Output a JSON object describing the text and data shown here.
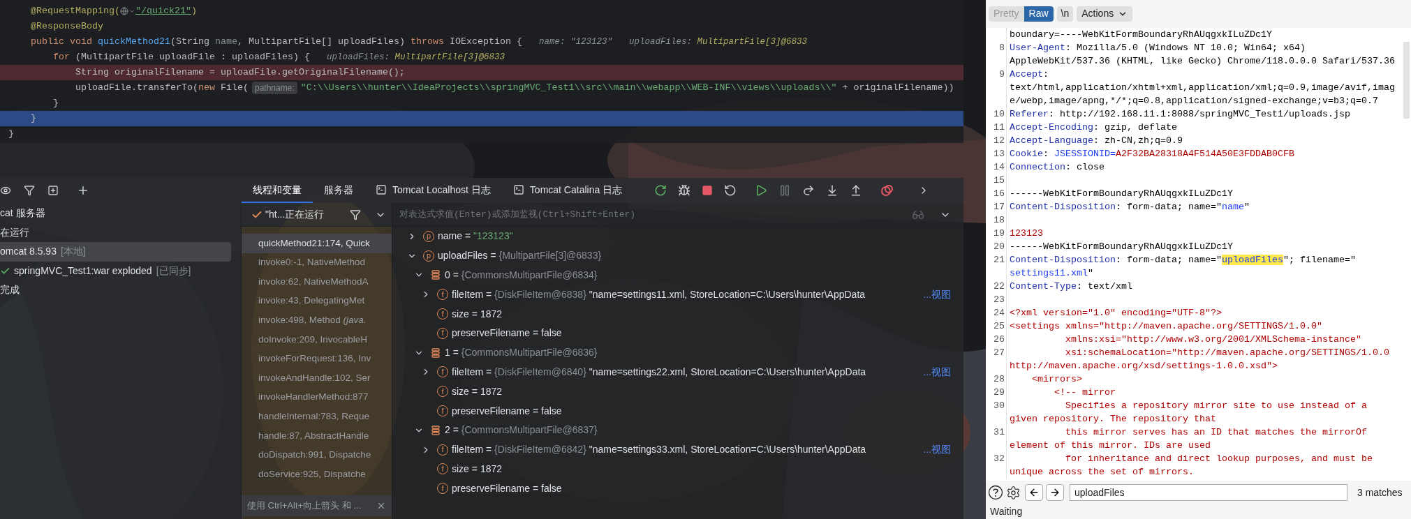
{
  "editor": {
    "lines": [
      {
        "parts": [
          {
            "kind": "code",
            "tokens": [
              {
                "kind": "annotation",
                "text": "    @RequestMapping("
              }
            ]
          },
          {
            "kind": "icon"
          },
          {
            "kind": "code",
            "tokens": [
              {
                "kind": "link",
                "text": "\"/quick21\""
              },
              {
                "kind": "annotation",
                "text": ")"
              }
            ]
          }
        ]
      },
      {
        "parts": [
          {
            "kind": "code",
            "tokens": [
              {
                "kind": "annotation",
                "text": "    @ResponseBody"
              }
            ]
          }
        ]
      },
      {
        "parts": [
          {
            "kind": "code",
            "tokens": [
              {
                "kind": "keyword",
                "text": "    public void "
              },
              {
                "kind": "method",
                "text": "quickMethod21"
              },
              {
                "kind": "plain",
                "text": "(String "
              },
              {
                "kind": "unused",
                "text": "name"
              },
              {
                "kind": "plain",
                "text": ", MultipartFile[] uploadFiles) "
              },
              {
                "kind": "keyword",
                "text": "throws "
              },
              {
                "kind": "plain",
                "text": "IOException {"
              }
            ]
          },
          {
            "kind": "hint",
            "tokens": [
              {
                "kind": "hint",
                "text": "name: \"123123\""
              }
            ]
          },
          {
            "kind": "hint",
            "tokens": [
              {
                "kind": "hint",
                "text": "uploadFiles: "
              },
              {
                "kind": "hint-type",
                "text": "MultipartFile[3]@6833"
              }
            ]
          }
        ]
      },
      {
        "parts": [
          {
            "kind": "code",
            "tokens": [
              {
                "kind": "keyword",
                "text": "        for "
              },
              {
                "kind": "plain",
                "text": "(MultipartFile uploadFile : uploadFiles) {"
              }
            ]
          },
          {
            "kind": "hint",
            "tokens": [
              {
                "kind": "hint",
                "text": "uploadFiles: "
              },
              {
                "kind": "hint-type",
                "text": "MultipartFile[3]@6833"
              }
            ]
          }
        ]
      },
      {
        "breakpoint": true,
        "current": false,
        "parts": [
          {
            "kind": "code",
            "tokens": [
              {
                "kind": "plain",
                "text": "            String originalFilename = uploadFile.getOriginalFilename();"
              }
            ]
          }
        ]
      },
      {
        "parts": [
          {
            "kind": "code",
            "tokens": [
              {
                "kind": "plain",
                "text": "            uploadFile.transferTo("
              },
              {
                "kind": "keyword",
                "text": "new "
              },
              {
                "kind": "plain",
                "text": "File("
              }
            ]
          },
          {
            "kind": "param-hint",
            "text": "pathname:"
          },
          {
            "kind": "code",
            "tokens": [
              {
                "kind": "string",
                "text": "\"C:\\\\Users\\\\hunter\\\\IdeaProjects\\\\springMVC_Test1\\\\src\\\\main\\\\webapp\\\\WEB-INF\\\\views\\\\uploads\\\\\""
              },
              {
                "kind": "plain",
                "text": " + originalFilename))"
              }
            ]
          }
        ]
      },
      {
        "parts": [
          {
            "kind": "code",
            "tokens": [
              {
                "kind": "plain",
                "text": "        }"
              }
            ]
          }
        ]
      },
      {
        "breakpoint": false,
        "current": true,
        "parts": [
          {
            "kind": "code",
            "tokens": [
              {
                "kind": "plain",
                "text": "    }"
              }
            ]
          }
        ]
      },
      {
        "parts": [
          {
            "kind": "code",
            "tokens": [
              {
                "kind": "plain",
                "text": "}"
              }
            ]
          }
        ]
      }
    ]
  },
  "services": {
    "items": [
      {
        "label": "cat 服务器",
        "selected": false
      },
      {
        "label": "在运行",
        "selected": false
      },
      {
        "label": "omcat 8.5.93",
        "tag": "[本地]",
        "selected": true
      },
      {
        "label": "springMVC_Test1:war exploded",
        "tag": "[已同步]",
        "done": true,
        "selected": false
      },
      {
        "label": "完成",
        "selected": false
      }
    ]
  },
  "debugger": {
    "tabs": [
      {
        "label": "线程和变量",
        "kind": "view",
        "selected": true
      },
      {
        "label": "服务器",
        "kind": "view",
        "selected": false
      },
      {
        "label": "Tomcat Localhost 日志",
        "kind": "console",
        "selected": false
      },
      {
        "label": "Tomcat Catalina 日志",
        "kind": "console",
        "selected": false
      }
    ],
    "thread": "\"ht...正在运行",
    "eval_placeholder": "对表达式求值(Enter)或添加监视(Ctrl+Shift+Enter)",
    "frames": [
      {
        "label": "quickMethod21:174, Quick",
        "selected": true
      },
      {
        "label": "invoke0:-1, NativeMethod",
        "selected": false
      },
      {
        "label": "invoke:62, NativeMethodA",
        "selected": false
      },
      {
        "label": "invoke:43, DelegatingMet",
        "selected": false
      },
      {
        "label": "invoke:498, Method *(java.*",
        "selected": false
      },
      {
        "label": "doInvoke:209, InvocableH",
        "selected": false
      },
      {
        "label": "invokeForRequest:136, Inv",
        "selected": false
      },
      {
        "label": "invokeAndHandle:102, Ser",
        "selected": false
      },
      {
        "label": "invokeHandlerMethod:877",
        "selected": false
      },
      {
        "label": "handleInternal:783, Reque",
        "selected": false
      },
      {
        "label": "handle:87, AbstractHandle",
        "selected": false
      },
      {
        "label": "doDispatch:991, Dispatche",
        "selected": false
      },
      {
        "label": "doService:925, Dispatche",
        "selected": false
      }
    ],
    "frames_hint": "使用 Ctrl+Alt+向上箭头 和 ...",
    "variables": [
      {
        "kind": "param",
        "badge": "p",
        "name": "name",
        "operator": "=",
        "value": "\"123123\"",
        "string_value": true,
        "expanded": false
      },
      {
        "kind": "param",
        "badge": "p",
        "name": "uploadFiles",
        "operator": "=",
        "type": "{MultipartFile[3]@6833}",
        "expanded": true,
        "children": [
          {
            "kind": "object",
            "name": "0",
            "operator": "=",
            "type": "{CommonsMultipartFile@6834}",
            "expanded": true,
            "children": [
              {
                "kind": "field",
                "badge": "f",
                "name": "fileItem",
                "operator": "=",
                "type": "{DiskFileItem@6838}",
                "value": "\"name=settings11.xml, StoreLocation=C:\\Users\\hunter\\AppData",
                "string_value": false,
                "link": "...视图",
                "expanded": false
              },
              {
                "kind": "field",
                "badge": "f",
                "name": "size",
                "operator": "=",
                "value": "1872",
                "string_value": false
              },
              {
                "kind": "field",
                "badge": "f",
                "name": "preserveFilename",
                "operator": "=",
                "value": "false",
                "string_value": false
              }
            ]
          },
          {
            "kind": "object",
            "name": "1",
            "operator": "=",
            "type": "{CommonsMultipartFile@6836}",
            "expanded": true,
            "children": [
              {
                "kind": "field",
                "badge": "f",
                "name": "fileItem",
                "operator": "=",
                "type": "{DiskFileItem@6840}",
                "value": "\"name=settings22.xml, StoreLocation=C:\\Users\\hunter\\AppData",
                "string_value": false,
                "link": "...视图",
                "expanded": false
              },
              {
                "kind": "field",
                "badge": "f",
                "name": "size",
                "operator": "=",
                "value": "1872",
                "string_value": false
              },
              {
                "kind": "field",
                "badge": "f",
                "name": "preserveFilename",
                "operator": "=",
                "value": "false",
                "string_value": false
              }
            ]
          },
          {
            "kind": "object",
            "name": "2",
            "operator": "=",
            "type": "{CommonsMultipartFile@6837}",
            "expanded": true,
            "children": [
              {
                "kind": "field",
                "badge": "f",
                "name": "fileItem",
                "operator": "=",
                "type": "{DiskFileItem@6842}",
                "value": "\"name=settings33.xml, StoreLocation=C:\\Users\\hunter\\AppData",
                "string_value": false,
                "link": "...视图",
                "expanded": false
              },
              {
                "kind": "field",
                "badge": "f",
                "name": "size",
                "operator": "=",
                "value": "1872",
                "string_value": false
              },
              {
                "kind": "field",
                "badge": "f",
                "name": "preserveFilename",
                "operator": "=",
                "value": "false",
                "string_value": false
              }
            ]
          }
        ]
      }
    ]
  },
  "request_panel": {
    "view_buttons": [
      {
        "label": "Pretty",
        "selected": false
      },
      {
        "label": "Raw",
        "selected": true
      }
    ],
    "newline_button": "\\n",
    "actions_button": "Actions",
    "lines": [
      {
        "rows": [
          {
            "spans": [
              {
                "kind": "plain",
                "text": "boundary=----WebKitFormBoundaryRhAUqgxkILuZDc1Y"
              }
            ]
          }
        ]
      },
      {
        "n": "8",
        "rows": [
          {
            "spans": [
              {
                "kind": "header",
                "text": "User-Agent"
              },
              {
                "kind": "plain",
                "text": ": Mozilla/5.0 (Windows NT 10.0; Win64; x64)"
              }
            ]
          },
          {
            "spans": [
              {
                "kind": "plain",
                "text": "AppleWebKit/537.36 (KHTML, like Gecko) Chrome/118.0.0.0 Safari/537.36"
              }
            ]
          }
        ]
      },
      {
        "n": "9",
        "rows": [
          {
            "spans": [
              {
                "kind": "header",
                "text": "Accept"
              },
              {
                "kind": "plain",
                "text": ":"
              }
            ]
          },
          {
            "spans": [
              {
                "kind": "plain",
                "text": "text/html,application/xhtml+xml,application/xml;q=0.9,image/avif,imag"
              }
            ]
          },
          {
            "spans": [
              {
                "kind": "plain",
                "text": "e/webp,image/apng,*/*;q=0.8,application/signed-exchange;v=b3;q=0.7"
              }
            ]
          }
        ]
      },
      {
        "n": "10",
        "rows": [
          {
            "spans": [
              {
                "kind": "header",
                "text": "Referer"
              },
              {
                "kind": "plain",
                "text": ": http://192.168.11.1:8088/springMVC_Test1/uploads.jsp"
              }
            ]
          }
        ]
      },
      {
        "n": "11",
        "rows": [
          {
            "spans": [
              {
                "kind": "header",
                "text": "Accept-Encoding"
              },
              {
                "kind": "plain",
                "text": ": gzip, deflate"
              }
            ]
          }
        ]
      },
      {
        "n": "12",
        "rows": [
          {
            "spans": [
              {
                "kind": "header",
                "text": "Accept-Language"
              },
              {
                "kind": "plain",
                "text": ": zh-CN,zh;q=0.9"
              }
            ]
          }
        ]
      },
      {
        "n": "13",
        "rows": [
          {
            "spans": [
              {
                "kind": "header",
                "text": "Cookie"
              },
              {
                "kind": "plain",
                "text": ": "
              },
              {
                "kind": "name",
                "text": "JSESSIONID="
              },
              {
                "kind": "value",
                "text": "A2F32BA28318A4F514A50E3FDDAB0CFB"
              }
            ]
          }
        ]
      },
      {
        "n": "14",
        "rows": [
          {
            "spans": [
              {
                "kind": "header",
                "text": "Connection"
              },
              {
                "kind": "plain",
                "text": ": close"
              }
            ]
          }
        ]
      },
      {
        "n": "15"
      },
      {
        "n": "16",
        "rows": [
          {
            "spans": [
              {
                "kind": "plain",
                "text": "------WebKitFormBoundaryRhAUqgxkILuZDc1Y"
              }
            ]
          }
        ]
      },
      {
        "n": "17",
        "rows": [
          {
            "spans": [
              {
                "kind": "header",
                "text": "Content-Disposition"
              },
              {
                "kind": "plain",
                "text": ": form-data; name=\""
              },
              {
                "kind": "name",
                "text": "name"
              },
              {
                "kind": "plain",
                "text": "\""
              }
            ]
          }
        ]
      },
      {
        "n": "18"
      },
      {
        "n": "19",
        "rows": [
          {
            "spans": [
              {
                "kind": "value",
                "text": "123123"
              }
            ]
          }
        ]
      },
      {
        "n": "20",
        "rows": [
          {
            "spans": [
              {
                "kind": "plain",
                "text": "------WebKitFormBoundaryRhAUqgxkILuZDc1Y"
              }
            ]
          }
        ]
      },
      {
        "n": "21",
        "rows": [
          {
            "spans": [
              {
                "kind": "header",
                "text": "Content-Disposition"
              },
              {
                "kind": "plain",
                "text": ": form-data; name=\""
              },
              {
                "kind": "match",
                "text": "uploadFiles"
              },
              {
                "kind": "plain",
                "text": "\"; filename=\""
              }
            ]
          },
          {
            "spans": [
              {
                "kind": "name",
                "text": "settings11.xml"
              },
              {
                "kind": "plain",
                "text": "\""
              }
            ]
          }
        ]
      },
      {
        "n": "22",
        "rows": [
          {
            "spans": [
              {
                "kind": "header",
                "text": "Content-Type"
              },
              {
                "kind": "plain",
                "text": ": text/xml"
              }
            ]
          }
        ]
      },
      {
        "n": "23"
      },
      {
        "n": "24",
        "rows": [
          {
            "spans": [
              {
                "kind": "value",
                "text": "<?xml version=\"1.0\" encoding=\"UTF-8\"?>"
              }
            ]
          }
        ]
      },
      {
        "n": "25",
        "rows": [
          {
            "spans": [
              {
                "kind": "value",
                "text": "<settings xmlns=\"http://maven.apache.org/SETTINGS/1.0.0\""
              }
            ]
          }
        ]
      },
      {
        "n": "26",
        "rows": [
          {
            "spans": [
              {
                "kind": "value",
                "text": "          xmlns:xsi=\"http://www.w3.org/2001/XMLSchema-instance\""
              }
            ]
          }
        ]
      },
      {
        "n": "27",
        "rows": [
          {
            "spans": [
              {
                "kind": "value",
                "text": "          xsi:schemaLocation=\"http://maven.apache.org/SETTINGS/1.0.0"
              }
            ]
          },
          {
            "spans": [
              {
                "kind": "value",
                "text": "http://maven.apache.org/xsd/settings-1.0.0.xsd\">"
              }
            ]
          }
        ]
      },
      {
        "n": "28",
        "rows": [
          {
            "spans": [
              {
                "kind": "value",
                "text": "    <mirrors>"
              }
            ]
          }
        ]
      },
      {
        "n": "29",
        "rows": [
          {
            "spans": [
              {
                "kind": "value",
                "text": "        <!-- mirror"
              }
            ]
          }
        ]
      },
      {
        "n": "30",
        "rows": [
          {
            "spans": [
              {
                "kind": "value",
                "text": "          Specifies a repository mirror site to use instead of a"
              }
            ]
          },
          {
            "spans": [
              {
                "kind": "value",
                "text": "given repository. The repository that"
              }
            ]
          }
        ]
      },
      {
        "n": "31",
        "rows": [
          {
            "spans": [
              {
                "kind": "value",
                "text": "          this mirror serves has an ID that matches the mirrorOf"
              }
            ]
          },
          {
            "spans": [
              {
                "kind": "value",
                "text": "element of this mirror. IDs are used"
              }
            ]
          }
        ]
      },
      {
        "n": "32",
        "rows": [
          {
            "spans": [
              {
                "kind": "value",
                "text": "          for inheritance and direct lookup purposes, and must be"
              }
            ]
          },
          {
            "spans": [
              {
                "kind": "value",
                "text": "unique across the set of mirrors."
              }
            ]
          }
        ]
      }
    ],
    "search": {
      "value": "uploadFiles",
      "matches": "3 matches"
    },
    "status": "Waiting"
  }
}
